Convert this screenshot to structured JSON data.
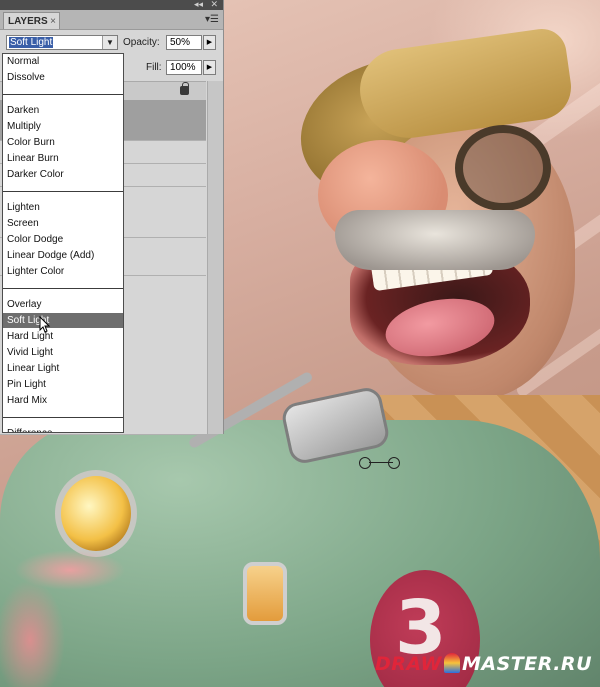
{
  "panel": {
    "tab_label": "LAYERS",
    "tab_close": "×",
    "collapse_icon": "double-chevron-icon",
    "close_icon": "close-icon",
    "menu_icon": "panel-menu-icon",
    "blend_mode": "Soft Light",
    "opacity_label": "Opacity:",
    "opacity_value": "50%",
    "fill_label": "Fill:",
    "fill_value": "100%"
  },
  "blend_menu": {
    "groups": [
      [
        "Normal",
        "Dissolve"
      ],
      [
        "Darken",
        "Multiply",
        "Color Burn",
        "Linear Burn",
        "Darker Color"
      ],
      [
        "Lighten",
        "Screen",
        "Color Dodge",
        "Linear Dodge (Add)",
        "Lighter Color"
      ],
      [
        "Overlay",
        "Soft Light",
        "Hard Light",
        "Vivid Light",
        "Linear Light",
        "Pin Light",
        "Hard Mix"
      ],
      [
        "Difference"
      ]
    ],
    "highlighted": "Soft Light"
  },
  "artwork": {
    "car_number": "3",
    "watermark_part1": "DRAW",
    "watermark_part2": "MASTER.RU"
  },
  "colors": {
    "panel_bg": "#d6d6d6",
    "menu_highlight": "#6e6e6e",
    "selected_value_bg": "#3a5fa8",
    "watermark_red": "#e0253a"
  }
}
